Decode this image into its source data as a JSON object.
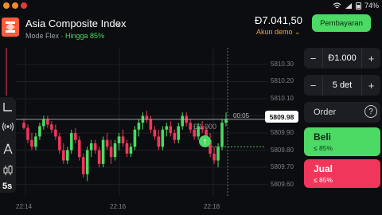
{
  "status_bar": {
    "battery_pct": "74%",
    "icons": [
      "orange-circle-icon",
      "orange-circle-icon",
      "red-circle-icon",
      "wifi-icon",
      "signal-icon",
      "battery-icon"
    ]
  },
  "header": {
    "title": "Asia Composite Index",
    "mode_label": "Mode Flex",
    "separator": " · ",
    "payout_label": "Hingga 85%",
    "balance": "Đ7.041,50",
    "account_label": "Akun demo",
    "pay_button": "Pembayaran"
  },
  "chart_data": {
    "type": "candlestick",
    "current_price": "5809.98",
    "timer": "00:05",
    "trade_amount_label": "Đ1.000",
    "y_ticks": [
      "5810.30",
      "5810.20",
      "5810.10",
      "5810.00",
      "5809.90",
      "5809.80",
      "5809.70",
      "5809.60"
    ],
    "x_ticks": [
      "22:14",
      "22:16",
      "22:18"
    ],
    "ylim": [
      5809.58,
      5810.36
    ],
    "colors": {
      "up": "#4cd964",
      "down": "#f0365a"
    },
    "candles": [
      [
        5809.96,
        5809.98,
        5809.92,
        5809.93
      ],
      [
        5809.93,
        5809.95,
        5809.84,
        5809.86
      ],
      [
        5809.86,
        5809.9,
        5809.8,
        5809.82
      ],
      [
        5809.82,
        5809.9,
        5809.8,
        5809.88
      ],
      [
        5809.88,
        5809.96,
        5809.86,
        5809.94
      ],
      [
        5809.94,
        5810.0,
        5809.92,
        5809.98
      ],
      [
        5809.98,
        5810.0,
        5809.93,
        5809.95
      ],
      [
        5809.95,
        5809.97,
        5809.9,
        5809.92
      ],
      [
        5809.92,
        5809.95,
        5809.86,
        5809.88
      ],
      [
        5809.88,
        5809.9,
        5809.78,
        5809.8
      ],
      [
        5809.8,
        5809.84,
        5809.72,
        5809.74
      ],
      [
        5809.74,
        5809.82,
        5809.72,
        5809.8
      ],
      [
        5809.8,
        5809.92,
        5809.78,
        5809.9
      ],
      [
        5809.9,
        5809.93,
        5809.84,
        5809.86
      ],
      [
        5809.86,
        5809.88,
        5809.74,
        5809.76
      ],
      [
        5809.76,
        5809.78,
        5809.64,
        5809.66
      ],
      [
        5809.66,
        5809.82,
        5809.62,
        5809.8
      ],
      [
        5809.8,
        5809.86,
        5809.76,
        5809.84
      ],
      [
        5809.84,
        5809.86,
        5809.78,
        5809.8
      ],
      [
        5809.8,
        5809.82,
        5809.7,
        5809.72
      ],
      [
        5809.72,
        5809.88,
        5809.7,
        5809.86
      ],
      [
        5809.86,
        5809.9,
        5809.8,
        5809.82
      ],
      [
        5809.82,
        5809.86,
        5809.72,
        5809.76
      ],
      [
        5809.76,
        5809.86,
        5809.74,
        5809.84
      ],
      [
        5809.84,
        5809.9,
        5809.8,
        5809.88
      ],
      [
        5809.88,
        5809.92,
        5809.82,
        5809.84
      ],
      [
        5809.84,
        5809.86,
        5809.76,
        5809.78
      ],
      [
        5809.78,
        5809.84,
        5809.76,
        5809.82
      ],
      [
        5809.82,
        5809.94,
        5809.8,
        5809.92
      ],
      [
        5809.92,
        5809.98,
        5809.88,
        5809.96
      ],
      [
        5809.96,
        5810.02,
        5809.92,
        5810.0
      ],
      [
        5810.0,
        5810.03,
        5809.96,
        5809.98
      ],
      [
        5809.98,
        5810.0,
        5809.9,
        5809.92
      ],
      [
        5809.92,
        5809.94,
        5809.86,
        5809.88
      ],
      [
        5809.88,
        5809.92,
        5809.8,
        5809.82
      ],
      [
        5809.82,
        5809.94,
        5809.8,
        5809.92
      ],
      [
        5809.92,
        5809.96,
        5809.88,
        5809.94
      ],
      [
        5809.94,
        5809.97,
        5809.88,
        5809.9
      ],
      [
        5809.9,
        5809.92,
        5809.84,
        5809.86
      ],
      [
        5809.86,
        5809.96,
        5809.84,
        5809.94
      ],
      [
        5809.94,
        5810.02,
        5809.92,
        5810.0
      ],
      [
        5810.0,
        5810.02,
        5809.94,
        5809.96
      ],
      [
        5809.96,
        5809.98,
        5809.9,
        5809.92
      ],
      [
        5809.92,
        5809.94,
        5809.86,
        5809.88
      ],
      [
        5809.88,
        5809.96,
        5809.86,
        5809.94
      ],
      [
        5809.94,
        5809.97,
        5809.9,
        5809.92
      ],
      [
        5809.92,
        5809.94,
        5809.84,
        5809.86
      ],
      [
        5809.86,
        5809.9,
        5809.76,
        5809.78
      ],
      [
        5809.78,
        5809.82,
        5809.72,
        5809.74
      ],
      [
        5809.74,
        5809.84,
        5809.7,
        5809.82
      ],
      [
        5809.82,
        5809.98,
        5809.8,
        5809.96
      ],
      [
        5809.96,
        5810.02,
        5809.94,
        5809.98
      ]
    ]
  },
  "toolbar": {
    "icons": [
      "indicators-icon",
      "signals-icon",
      "drawing-icon",
      "candles-icon"
    ],
    "timeframe": "5s"
  },
  "trade_panel": {
    "amount": "Đ1.000",
    "duration": "5 det",
    "minus": "−",
    "plus": "+",
    "order_label": "Order",
    "help": "?",
    "buy_label": "Beli",
    "buy_payout": "≤ 85%",
    "sell_label": "Jual",
    "sell_payout": "≤ 85%"
  }
}
